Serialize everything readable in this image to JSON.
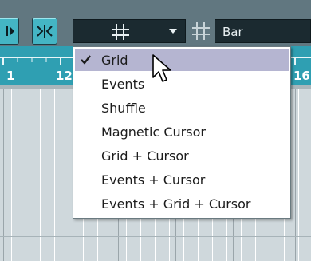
{
  "toolbar": {
    "snap_type_icon": "grid-icon",
    "quantize_value": "Bar"
  },
  "ruler": {
    "labels": [
      "1",
      "12",
      "16"
    ]
  },
  "snap_menu": {
    "items": [
      {
        "label": "Grid",
        "checked": true
      },
      {
        "label": "Events",
        "checked": false
      },
      {
        "label": "Shuffle",
        "checked": false
      },
      {
        "label": "Magnetic Cursor",
        "checked": false
      },
      {
        "label": "Grid + Cursor",
        "checked": false
      },
      {
        "label": "Events + Cursor",
        "checked": false
      },
      {
        "label": "Events + Grid + Cursor",
        "checked": false
      }
    ]
  },
  "colors": {
    "toolbar": "#5b6f79",
    "ruler": "#2f9fb2",
    "menu_highlight": "#b5b5d1",
    "track_background": "#cfd8dc"
  }
}
